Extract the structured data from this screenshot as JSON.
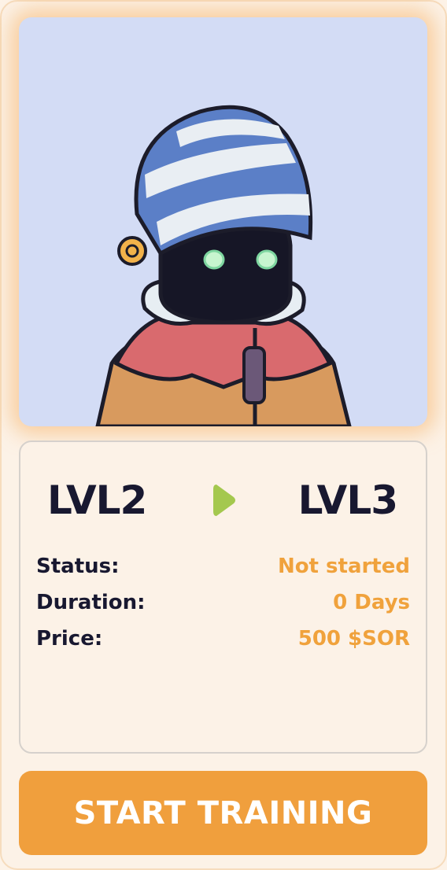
{
  "training": {
    "from_level": "LVL2",
    "to_level": "LVL3",
    "details": [
      {
        "label": "Status:",
        "value": "Not started"
      },
      {
        "label": "Duration:",
        "value": "0 Days"
      },
      {
        "label": "Price:",
        "value": "500 $SOR"
      }
    ],
    "action_label": "START TRAINING"
  },
  "colors": {
    "accent": "#f09f3d",
    "value_text": "#f0a23c",
    "arrow": "#a4c84e",
    "dark_text": "#181830",
    "portrait_bg": "#d3dcf5"
  },
  "icons": {
    "level_arrow": "play-arrow-icon"
  }
}
